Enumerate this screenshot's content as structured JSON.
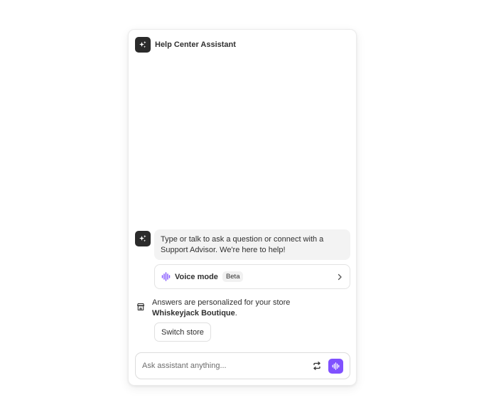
{
  "header": {
    "title": "Help Center Assistant",
    "avatar_icon": "sparkle-icon"
  },
  "message": {
    "text": "Type or talk to ask a question or connect with a Support Advisor. We're here to help!"
  },
  "voice_mode": {
    "label": "Voice mode",
    "badge": "Beta",
    "icon": "waveform-icon",
    "accent_color": "#8051ff"
  },
  "store": {
    "text_prefix": "Answers are personalized for your store",
    "store_name": "Whiskeyjack Boutique",
    "text_suffix": ".",
    "icon": "store-icon",
    "switch_label": "Switch store"
  },
  "composer": {
    "placeholder": "Ask assistant anything...",
    "value": "",
    "swap_icon": "swap-arrows-icon",
    "voice_icon": "waveform-icon",
    "voice_button_color": "#8051ff"
  }
}
